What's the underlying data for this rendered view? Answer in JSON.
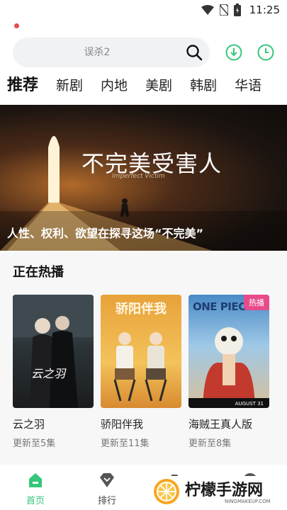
{
  "status": {
    "time": "11:25"
  },
  "search": {
    "placeholder": "误杀2"
  },
  "tabs": [
    "推荐",
    "新剧",
    "内地",
    "美剧",
    "韩剧",
    "华语"
  ],
  "banner": {
    "title": "不完美受害人",
    "subtitle": "Imperfect Victim",
    "caption": "人性、权利、欲望在探寻这场“不完美”"
  },
  "section": {
    "title": "正在热播"
  },
  "cards": [
    {
      "title": "云之羽",
      "subtitle": "更新至5集",
      "poster_text": "云之羽"
    },
    {
      "title": "骄阳伴我",
      "subtitle": "更新至11集",
      "poster_text": "骄阳伴我"
    },
    {
      "title": "海贼王真人版",
      "subtitle": "更新至8集",
      "poster_text": "ONE PIECE",
      "badge": "热播",
      "poster_small": "AUGUST 31"
    }
  ],
  "nav": {
    "home": "首页",
    "rank": "排行"
  },
  "watermark": {
    "text": "柠檬手游网",
    "sub": "NINGMAKEUP.COM"
  },
  "colors": {
    "accent": "#34c77b",
    "badge": "#e84b8a",
    "dot": "#e84a4a"
  }
}
